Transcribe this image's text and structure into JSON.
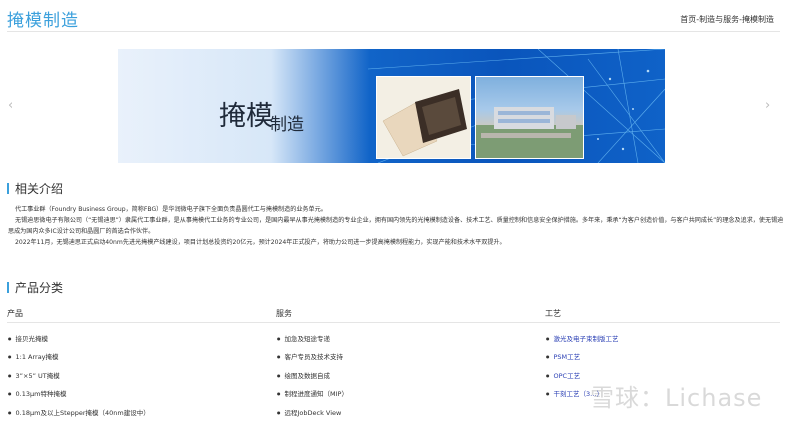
{
  "page": {
    "title": "掩模制造",
    "breadcrumb": [
      "首页",
      "-制造与服务",
      "-掩模制造"
    ]
  },
  "banner": {
    "main_text": "掩模",
    "sub_text": "制造",
    "prev_icon": "chevron-left-icon",
    "next_icon": "chevron-right-icon",
    "prev_symbol": "‹",
    "next_symbol": "›",
    "colors": {
      "accent": "#3ba0dc",
      "blue": "#0a55bc"
    }
  },
  "intro": {
    "heading": "相关介绍",
    "p1": "代工事业群（Foundry Business Group，简称FBG）是华润微电子旗下全面负责晶圆代工与掩模制造的业务单元。",
    "p2": "无锡迪思微电子有限公司（“无锡迪思”）隶属代工事业群，是从事掩模代工业务的专业公司，是国内最早从事光掩模制造的专业企业，拥有国内领先的光掩模制造设备、技术工艺、质量控制和信息安全保护措施。多年来，秉承“为客户创造价值，与客户共同成长”的理念及追求，使无锡迪思成为国内众多IC设计公司和晶圆厂的首选合作伙伴。",
    "p3": "2022年11月，无锡迪思正式启动40nm先进光掩模产线建设，项目计划总投资约20亿元，预计2024年正式投产，将助力公司进一步提高掩模制程能力，实现产能和技术水平双提升。"
  },
  "products": {
    "heading": "产品分类",
    "columns": [
      {
        "title": "产品",
        "items": [
          "接贝光掩模",
          "1:1 Array掩模",
          "3”×5” UT掩模",
          "0.13μm特种掩模",
          "0.18μm及以上Stepper掩模（40nm建设中）"
        ]
      },
      {
        "title": "服务",
        "items": [
          "加急及短途专递",
          "客户专员及技术支持",
          "绘图及数据自成",
          "制程进度通知（MIP）",
          "远程JobDeck View"
        ]
      },
      {
        "title": "工艺",
        "items": [
          "激光及电子束制版工艺",
          "PSM工艺",
          "OPC工艺",
          "干刻工艺（3…）"
        ]
      }
    ]
  },
  "watermark": "雪球：Lichase"
}
